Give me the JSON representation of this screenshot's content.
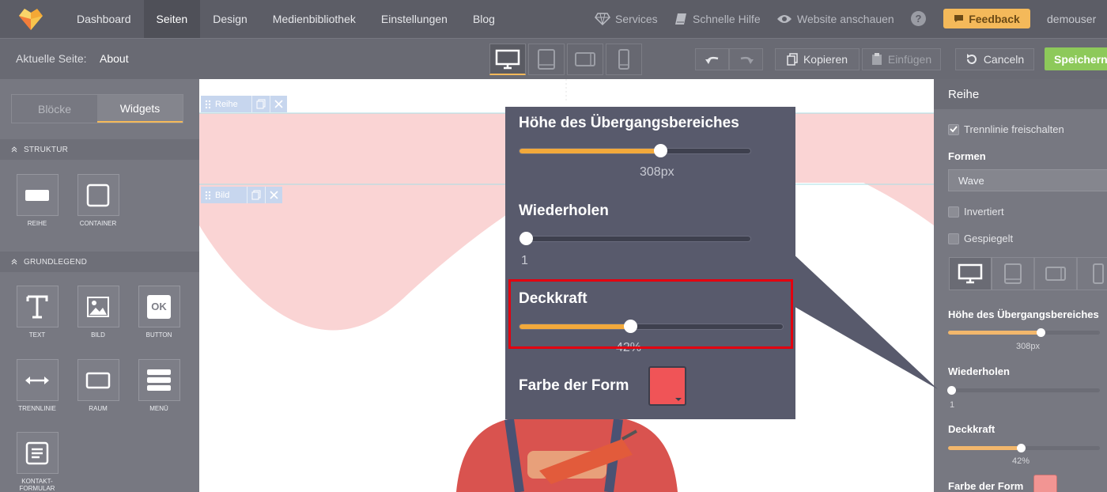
{
  "nav": {
    "items": [
      "Dashboard",
      "Seiten",
      "Design",
      "Medienbibliothek",
      "Einstellungen",
      "Blog"
    ],
    "active_index": 1,
    "services": "Services",
    "quick_help": "Schnelle Hilfe",
    "view_site": "Website anschauen",
    "help_symbol": "?",
    "feedback": "Feedback",
    "user": "demouser"
  },
  "toolbar": {
    "current_page_label": "Aktuelle Seite:",
    "current_page": "About",
    "copy": "Kopieren",
    "paste": "Einfügen",
    "cancel": "Canceln",
    "save": "Speichern"
  },
  "left": {
    "tabs": [
      "Blöcke",
      "Widgets"
    ],
    "active_tab": 1,
    "section_structure": "STRUKTUR",
    "section_basic": "GRUNDLEGEND",
    "widgets": {
      "row": "REIHE",
      "container": "CONTAINER",
      "text": "TEXT",
      "image": "BILD",
      "button": "BUTTON",
      "button_glyph": "OK",
      "divider": "TRENNLINIE",
      "space": "RAUM",
      "menu": "MENÜ",
      "contact_form": "KONTAKT-\nFORMULAR"
    }
  },
  "canvas": {
    "row_tag": "Reihe",
    "image_tag": "Bild"
  },
  "popup": {
    "transition_label": "Höhe des Übergangsbereiches",
    "transition_value": "308px",
    "transition_fraction": 0.61,
    "repeat_label": "Wiederholen",
    "repeat_value": "1",
    "repeat_fraction": 0.0,
    "opacity_label": "Deckkraft",
    "opacity_value": "42%",
    "opacity_fraction": 0.42,
    "color_label": "Farbe der Form",
    "color": "#f05457"
  },
  "right": {
    "title": "Reihe",
    "enable_divider": "Trennlinie freischalten",
    "enable_divider_checked": true,
    "shapes_label": "Formen",
    "shape_value": "Wave",
    "inverted": "Invertiert",
    "mirrored": "Gespiegelt",
    "transition_label": "Höhe des Übergangsbereiches",
    "transition_value": "308px",
    "repeat_label": "Wiederholen",
    "repeat_value": "1",
    "opacity_label": "Deckkraft",
    "opacity_value": "42%",
    "color_label": "Farbe der Form",
    "color": "#f29593"
  },
  "colors": {
    "accent": "#f4b95a",
    "save": "#8dc95a",
    "highlight": "#e3000f",
    "wave": "#fad4d4"
  }
}
